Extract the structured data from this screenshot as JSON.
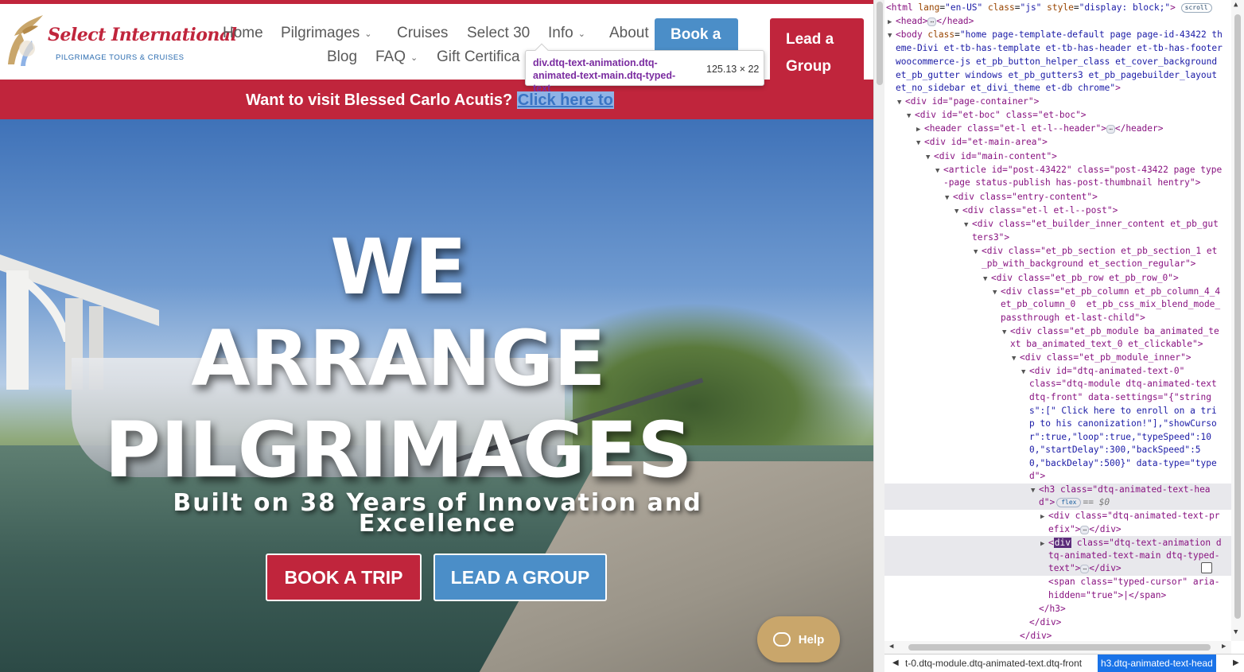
{
  "site": {
    "logo": {
      "title": "Select International",
      "subtitle": "PILGRIMAGE TOURS & CRUISES"
    },
    "nav": {
      "home": "Home",
      "pilgrimages": "Pilgrimages",
      "cruises": "Cruises",
      "select30": "Select 30",
      "info": "Info",
      "about": "About",
      "blog": "Blog",
      "faq": "FAQ",
      "gift": "Gift Certifica"
    },
    "book_button": "Book a",
    "lead_button_line1": "Lead a",
    "lead_button_line2": "Group",
    "banner": {
      "text": "Want to visit Blessed Carlo Acutis?",
      "link": "Click here to"
    },
    "hero": {
      "title_line1": "WE",
      "title_line2": "ARRANGE",
      "title_line3": "PILGRIMAGES",
      "subtitle_line1": "Built on 38 Years of Innovation and",
      "subtitle_line2": "Excellence",
      "book_trip": "BOOK A TRIP",
      "lead_group": "LEAD A GROUP"
    },
    "help_label": "Help",
    "colors": {
      "brand_red": "#c0253c",
      "brand_blue": "#4b8ec8",
      "help_gold": "#c9a66b"
    }
  },
  "tooltip": {
    "selector": "div.dtq-text-animation.dtq-animated-text-main.dtq-typed-text",
    "size": "125.13 × 22"
  },
  "devtools": {
    "l1_tag_open": "<html ",
    "l1_a1": "lang",
    "l1_v1": "\"en-US\"",
    "l1_a2": "class",
    "l1_v2": "\"js\"",
    "l1_a3": "style",
    "l1_v3": "\"display: block;\"",
    "l1_close": ">",
    "l1_pill": "scroll",
    "l2": "<head>",
    "l2_close": "</head>",
    "l3_tag": "<body ",
    "l3_attr": "class",
    "l3_val_1": "\"home page-template-default page page-id-43422 th",
    "l3_val_2": "eme-Divi et-tb-has-template et-tb-has-header et-tb-has-footer",
    "l3_val_3": "woocommerce-js et_pb_button_helper_class et_cover_background",
    "l3_val_4": "et_pb_gutter windows et_pb_gutters3 et_pb_pagebuilder_layout",
    "l3_val_5": "et_no_sidebar et_divi_theme et-db chrome\"",
    "l4": "<div id=\"page-container\">",
    "l5": "<div id=\"et-boc\" class=\"et-boc\">",
    "l6_a": "<header class=\"et-l et-l--header\">",
    "l6_b": "</header>",
    "l7": "<div id=\"et-main-area\">",
    "l8": "<div id=\"main-content\">",
    "l9_1": "<article id=\"post-43422\" class=\"post-43422 page type",
    "l9_2": "-page status-publish has-post-thumbnail hentry\">",
    "l10": "<div class=\"entry-content\">",
    "l11": "<div class=\"et-l et-l--post\">",
    "l12_1": "<div class=\"et_builder_inner_content et_pb_gut",
    "l12_2": "ters3\">",
    "l13_1": "<div class=\"et_pb_section et_pb_section_1 et",
    "l13_2": "_pb_with_background et_section_regular\">",
    "l14": "<div class=\"et_pb_row et_pb_row_0\">",
    "l15_1": "<div class=\"et_pb_column et_pb_column_4_4",
    "l15_2": "et_pb_column_0  et_pb_css_mix_blend_mode_",
    "l15_3": "passthrough et-last-child\">",
    "l16_1": "<div class=\"et_pb_module ba_animated_te",
    "l16_2": "xt ba_animated_text_0 et_clickable\">",
    "l17": "<div class=\"et_pb_module_inner\">",
    "l18_1": "<div id=\"dtq-animated-text-0\"",
    "l18_2": "class=\"dtq-module dtq-animated-text",
    "l18_3": "dtq-front\" data-settings=\"{\"string",
    "l18_4": "s\":[\" Click here to enroll on a tri",
    "l18_5": "p to his canonization!\"],\"showCurso",
    "l18_6": "r\":true,\"loop\":true,\"typeSpeed\":10",
    "l18_7": "0,\"startDelay\":300,\"backSpeed\":5",
    "l18_8": "0,\"backDelay\":500}\" data-type=\"type",
    "l18_9": "d\">",
    "l19_1": "<h3 class=\"dtq-animated-text-hea",
    "l19_2": "d\">",
    "l19_pill": "flex",
    "l19_eq": "== $0",
    "l20_1": "<div class=\"dtq-animated-text-pr",
    "l20_2": "efix\">",
    "l20_3": "</div>",
    "l21_tag": "div",
    "l21_1": " class=\"dtq-text-animation d",
    "l21_2": "tq-animated-text-main dtq-typed-",
    "l21_3": "text\">",
    "l21_4": "</div>",
    "l22_1": "<span class=\"typed-cursor\" aria-",
    "l22_2": "hidden=\"true\">|</span>",
    "l23": "</h3>",
    "l24": "</div>",
    "l25": "</div>",
    "breadcrumb_1": "t-0.dtq-module.dtq-animated-text.dtq-front",
    "breadcrumb_2": "h3.dtq-animated-text-head"
  }
}
